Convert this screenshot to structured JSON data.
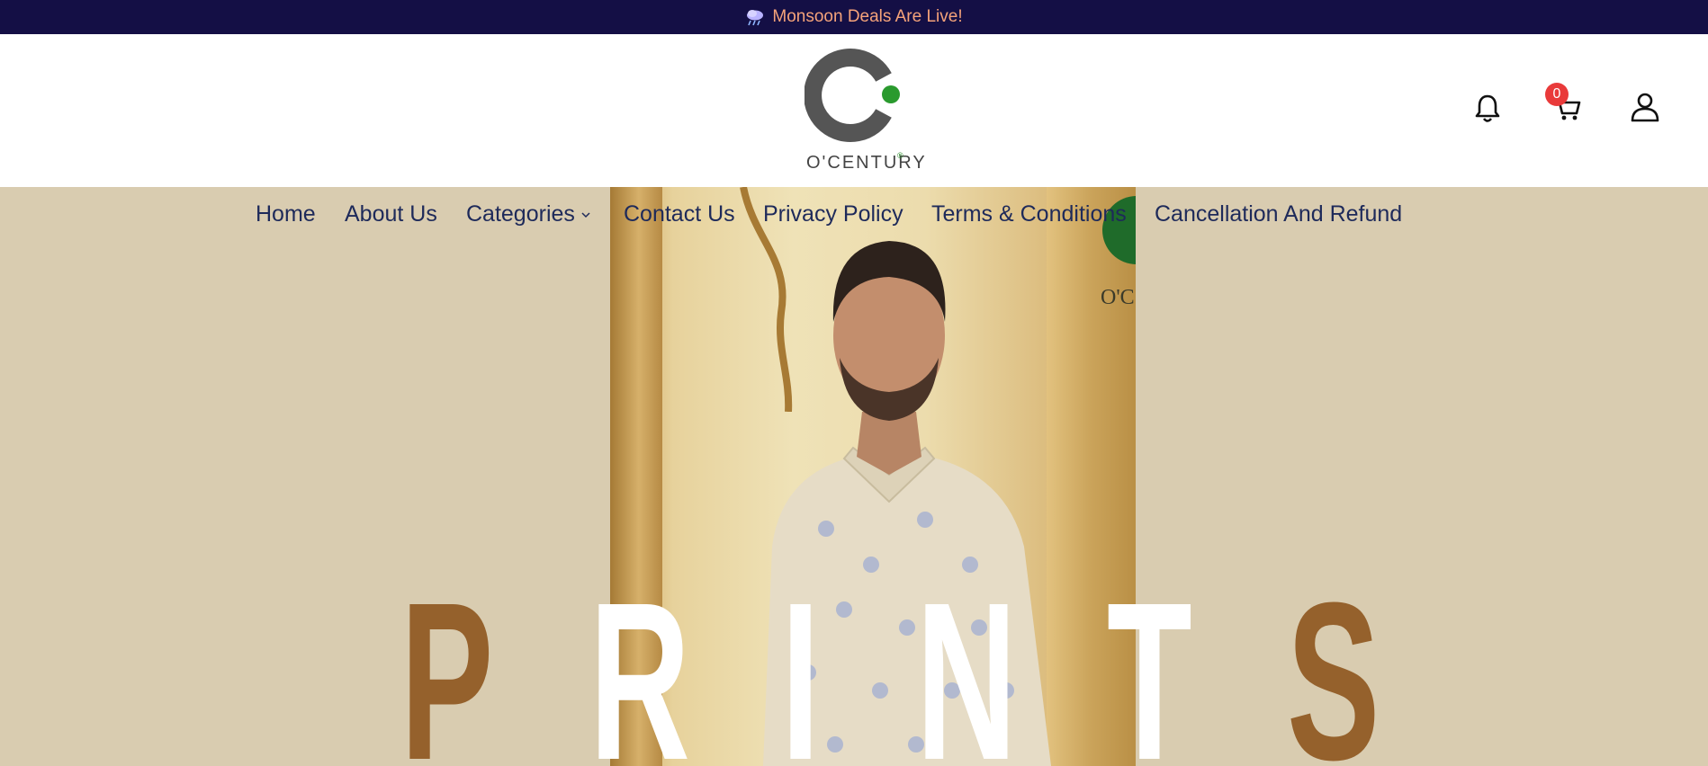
{
  "announcement": {
    "icon": "cloud-rain-icon",
    "text": "Monsoon Deals Are Live!",
    "background": "#140f45",
    "text_color": "#f5a37a"
  },
  "header": {
    "logo_text": "O'CENTURY",
    "logo_registered": "®",
    "icons": [
      "bell-icon",
      "cart-icon",
      "user-icon"
    ],
    "cart_count": "0",
    "badge_color": "#e93a3a"
  },
  "nav": {
    "items": [
      {
        "label": "Home"
      },
      {
        "label": "About Us"
      },
      {
        "label": "Categories",
        "has_dropdown": true
      },
      {
        "label": "Contact Us"
      },
      {
        "label": "Privacy Policy"
      },
      {
        "label": "Terms & Conditions"
      },
      {
        "label": "Cancellation And Refund"
      }
    ],
    "text_color": "#1e2a5a"
  },
  "hero": {
    "background": "#d9ccb0",
    "banner_logo_text": "O'C",
    "headline_letters": [
      "P",
      "R",
      "I",
      "N",
      "T",
      "S"
    ]
  }
}
